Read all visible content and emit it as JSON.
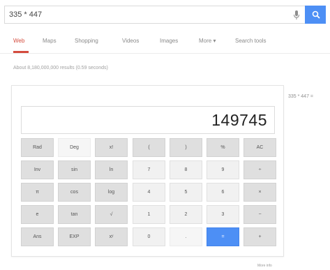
{
  "search": {
    "query": "335 * 447",
    "mic_icon": "mic-icon",
    "search_icon": "search-icon",
    "accent": "#4d8ff5"
  },
  "tabs": [
    {
      "label": "Web",
      "active": true
    },
    {
      "label": "Maps"
    },
    {
      "label": "Shopping"
    },
    {
      "label": "Videos"
    },
    {
      "label": "Images"
    },
    {
      "label": "More ▾"
    },
    {
      "label": "Search tools"
    }
  ],
  "tab_active_color": "#d44c3e",
  "result_stats": "About 8,180,000,000 results (0.59 seconds)",
  "calculator": {
    "expression": "335 * 447 =",
    "display": "149745",
    "rows": [
      [
        "Rad",
        "Deg",
        "x!",
        "(",
        ")",
        "%",
        "AC"
      ],
      [
        "Inv",
        "sin",
        "ln",
        "7",
        "8",
        "9",
        "÷"
      ],
      [
        "π",
        "cos",
        "log",
        "4",
        "5",
        "6",
        "×"
      ],
      [
        "e",
        "tan",
        "√",
        "1",
        "2",
        "3",
        "−"
      ],
      [
        "Ans",
        "EXP",
        "xʸ",
        "0",
        ".",
        "=",
        "+"
      ]
    ]
  },
  "footer_link": "More info"
}
